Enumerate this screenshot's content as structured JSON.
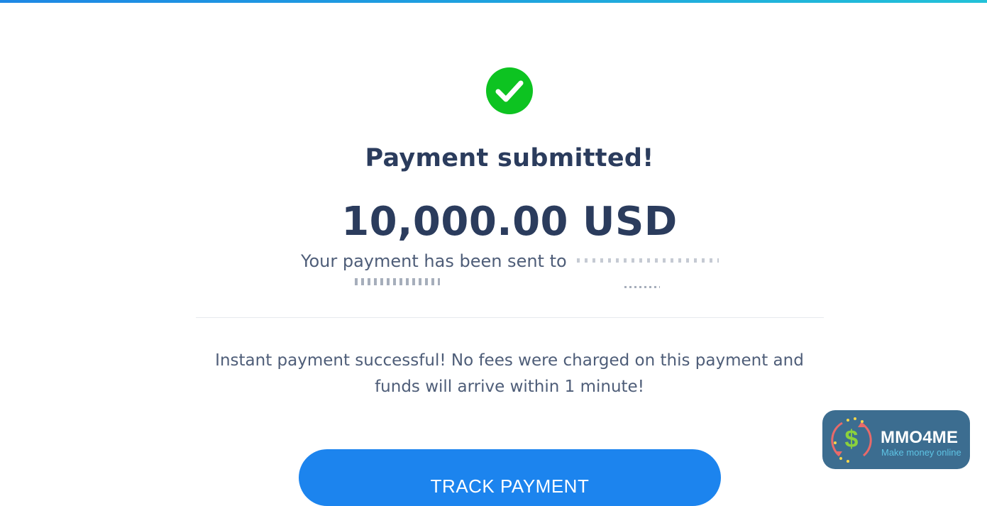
{
  "header": {
    "accent_gradient": [
      "#1e88e5",
      "#22c1d8"
    ]
  },
  "status": {
    "icon": "check-circle-icon",
    "icon_color": "#0dc321",
    "title": "Payment submitted!"
  },
  "payment": {
    "amount": "10,000.00 USD",
    "sent_to_text": "Your payment has been sent to"
  },
  "message": {
    "text": "Instant payment successful! No fees were charged on this payment and funds will arrive within 1 minute!"
  },
  "actions": {
    "track_label": "TRACK PAYMENT",
    "button_color": "#1c84ee"
  },
  "badge": {
    "name": "MMO4ME",
    "tagline": "Make money online",
    "background": "#3c6d90"
  }
}
